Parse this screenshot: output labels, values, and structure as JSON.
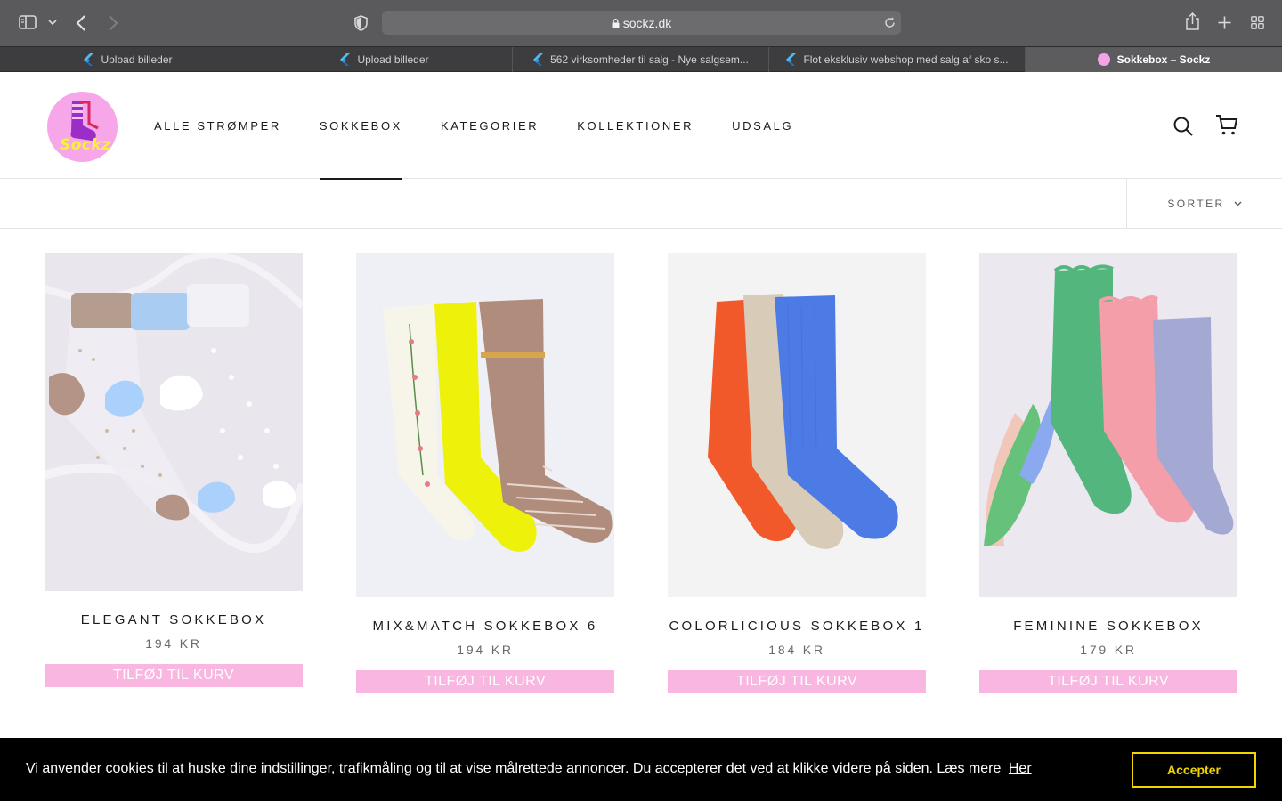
{
  "browser": {
    "url": "sockz.dk",
    "tabs": [
      {
        "label": "Upload billeder"
      },
      {
        "label": "Upload billeder"
      },
      {
        "label": "562 virksomheder til salg - Nye salgsem..."
      },
      {
        "label": "Flot eksklusiv webshop med salg af sko s..."
      },
      {
        "label": "Sokkebox – Sockz"
      }
    ]
  },
  "header": {
    "logo_text": "Sockz",
    "nav": [
      {
        "label": "ALLE STRØMPER"
      },
      {
        "label": "SOKKEBOX"
      },
      {
        "label": "KATEGORIER"
      },
      {
        "label": "KOLLEKTIONER"
      },
      {
        "label": "UDSALG"
      }
    ]
  },
  "sort": {
    "label": "SORTER"
  },
  "products": [
    {
      "title": "ELEGANT SOKKEBOX",
      "price": "194 KR",
      "button": "TILFØJ TIL KURV"
    },
    {
      "title": "MIX&MATCH SOKKEBOX 6",
      "price": "194 KR",
      "button": "TILFØJ TIL KURV"
    },
    {
      "title": "COLORLICIOUS SOKKEBOX 1",
      "price": "184 KR",
      "button": "TILFØJ TIL KURV"
    },
    {
      "title": "FEMININE SOKKEBOX",
      "price": "179 KR",
      "button": "TILFØJ TIL KURV"
    }
  ],
  "cookie": {
    "text": "Vi anvender cookies til at huske dine indstillinger, trafikmåling og til at vise målrettede annoncer. Du accepterer det ved at klikke videre på siden. Læs mere",
    "link": "Her",
    "accept": "Accepter"
  },
  "colors": {
    "button_pink": "#f9b6e1",
    "logo_pink": "#f7a6e9",
    "cookie_accent": "#f1d600"
  },
  "icons": [
    "sidebar-icon",
    "chevron-down-icon",
    "back-icon",
    "forward-icon",
    "shield-icon",
    "lock-icon",
    "reload-icon",
    "share-icon",
    "new-tab-icon",
    "tab-overview-icon",
    "search-icon",
    "cart-icon"
  ]
}
